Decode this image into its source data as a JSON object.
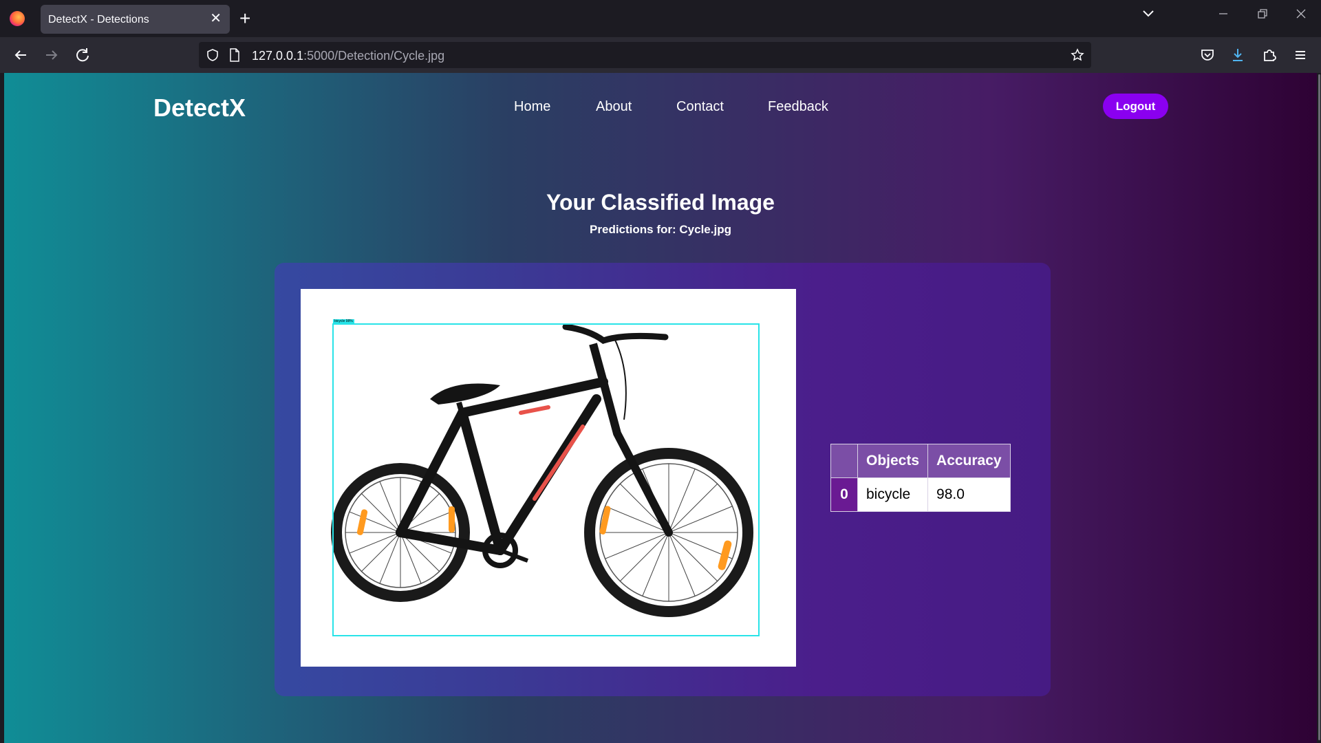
{
  "browser": {
    "tab_title": "DetectX - Detections",
    "tab_close": "✕",
    "new_tab": "+",
    "url_host": "127.0.0.1",
    "url_path": ":5000/Detection/Cycle.jpg"
  },
  "site": {
    "brand": "DetectX",
    "nav": [
      {
        "label": "Home"
      },
      {
        "label": "About"
      },
      {
        "label": "Contact"
      },
      {
        "label": "Feedback"
      }
    ],
    "logout_label": "Logout"
  },
  "main": {
    "heading": "Your Classified Image",
    "subheading": "Predictions for: Cycle.jpg",
    "detection_label": "bicycle   98%",
    "table": {
      "headers": [
        "",
        "Objects",
        "Accuracy"
      ],
      "rows": [
        {
          "index": "0",
          "object": "bicycle",
          "accuracy": "98.0"
        }
      ]
    }
  },
  "colors": {
    "accent": "#8a00f0",
    "bbox": "#28e3e8",
    "table_header": "#7b4ea6",
    "row_index": "#6a1a93"
  }
}
